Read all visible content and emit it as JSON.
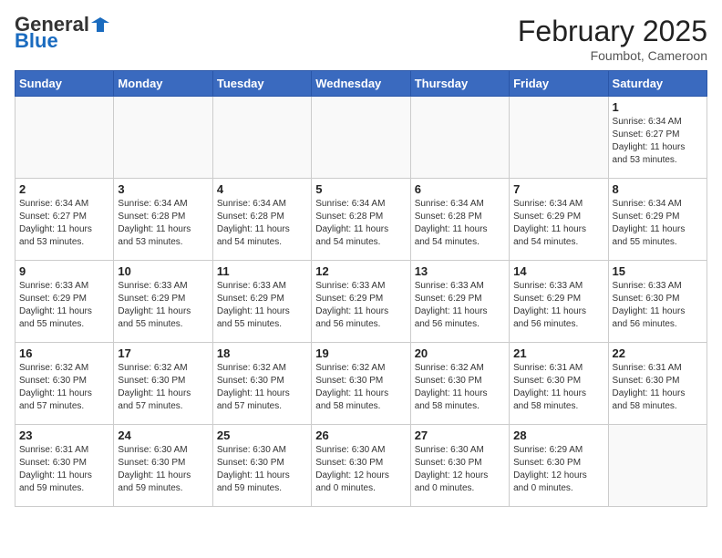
{
  "header": {
    "logo_general": "General",
    "logo_blue": "Blue",
    "month_year": "February 2025",
    "location": "Foumbot, Cameroon"
  },
  "weekdays": [
    "Sunday",
    "Monday",
    "Tuesday",
    "Wednesday",
    "Thursday",
    "Friday",
    "Saturday"
  ],
  "weeks": [
    [
      {
        "day": "",
        "info": ""
      },
      {
        "day": "",
        "info": ""
      },
      {
        "day": "",
        "info": ""
      },
      {
        "day": "",
        "info": ""
      },
      {
        "day": "",
        "info": ""
      },
      {
        "day": "",
        "info": ""
      },
      {
        "day": "1",
        "info": "Sunrise: 6:34 AM\nSunset: 6:27 PM\nDaylight: 11 hours\nand 53 minutes."
      }
    ],
    [
      {
        "day": "2",
        "info": "Sunrise: 6:34 AM\nSunset: 6:27 PM\nDaylight: 11 hours\nand 53 minutes."
      },
      {
        "day": "3",
        "info": "Sunrise: 6:34 AM\nSunset: 6:28 PM\nDaylight: 11 hours\nand 53 minutes."
      },
      {
        "day": "4",
        "info": "Sunrise: 6:34 AM\nSunset: 6:28 PM\nDaylight: 11 hours\nand 54 minutes."
      },
      {
        "day": "5",
        "info": "Sunrise: 6:34 AM\nSunset: 6:28 PM\nDaylight: 11 hours\nand 54 minutes."
      },
      {
        "day": "6",
        "info": "Sunrise: 6:34 AM\nSunset: 6:28 PM\nDaylight: 11 hours\nand 54 minutes."
      },
      {
        "day": "7",
        "info": "Sunrise: 6:34 AM\nSunset: 6:29 PM\nDaylight: 11 hours\nand 54 minutes."
      },
      {
        "day": "8",
        "info": "Sunrise: 6:34 AM\nSunset: 6:29 PM\nDaylight: 11 hours\nand 55 minutes."
      }
    ],
    [
      {
        "day": "9",
        "info": "Sunrise: 6:33 AM\nSunset: 6:29 PM\nDaylight: 11 hours\nand 55 minutes."
      },
      {
        "day": "10",
        "info": "Sunrise: 6:33 AM\nSunset: 6:29 PM\nDaylight: 11 hours\nand 55 minutes."
      },
      {
        "day": "11",
        "info": "Sunrise: 6:33 AM\nSunset: 6:29 PM\nDaylight: 11 hours\nand 55 minutes."
      },
      {
        "day": "12",
        "info": "Sunrise: 6:33 AM\nSunset: 6:29 PM\nDaylight: 11 hours\nand 56 minutes."
      },
      {
        "day": "13",
        "info": "Sunrise: 6:33 AM\nSunset: 6:29 PM\nDaylight: 11 hours\nand 56 minutes."
      },
      {
        "day": "14",
        "info": "Sunrise: 6:33 AM\nSunset: 6:29 PM\nDaylight: 11 hours\nand 56 minutes."
      },
      {
        "day": "15",
        "info": "Sunrise: 6:33 AM\nSunset: 6:30 PM\nDaylight: 11 hours\nand 56 minutes."
      }
    ],
    [
      {
        "day": "16",
        "info": "Sunrise: 6:32 AM\nSunset: 6:30 PM\nDaylight: 11 hours\nand 57 minutes."
      },
      {
        "day": "17",
        "info": "Sunrise: 6:32 AM\nSunset: 6:30 PM\nDaylight: 11 hours\nand 57 minutes."
      },
      {
        "day": "18",
        "info": "Sunrise: 6:32 AM\nSunset: 6:30 PM\nDaylight: 11 hours\nand 57 minutes."
      },
      {
        "day": "19",
        "info": "Sunrise: 6:32 AM\nSunset: 6:30 PM\nDaylight: 11 hours\nand 58 minutes."
      },
      {
        "day": "20",
        "info": "Sunrise: 6:32 AM\nSunset: 6:30 PM\nDaylight: 11 hours\nand 58 minutes."
      },
      {
        "day": "21",
        "info": "Sunrise: 6:31 AM\nSunset: 6:30 PM\nDaylight: 11 hours\nand 58 minutes."
      },
      {
        "day": "22",
        "info": "Sunrise: 6:31 AM\nSunset: 6:30 PM\nDaylight: 11 hours\nand 58 minutes."
      }
    ],
    [
      {
        "day": "23",
        "info": "Sunrise: 6:31 AM\nSunset: 6:30 PM\nDaylight: 11 hours\nand 59 minutes."
      },
      {
        "day": "24",
        "info": "Sunrise: 6:30 AM\nSunset: 6:30 PM\nDaylight: 11 hours\nand 59 minutes."
      },
      {
        "day": "25",
        "info": "Sunrise: 6:30 AM\nSunset: 6:30 PM\nDaylight: 11 hours\nand 59 minutes."
      },
      {
        "day": "26",
        "info": "Sunrise: 6:30 AM\nSunset: 6:30 PM\nDaylight: 12 hours\nand 0 minutes."
      },
      {
        "day": "27",
        "info": "Sunrise: 6:30 AM\nSunset: 6:30 PM\nDaylight: 12 hours\nand 0 minutes."
      },
      {
        "day": "28",
        "info": "Sunrise: 6:29 AM\nSunset: 6:30 PM\nDaylight: 12 hours\nand 0 minutes."
      },
      {
        "day": "",
        "info": ""
      }
    ]
  ]
}
